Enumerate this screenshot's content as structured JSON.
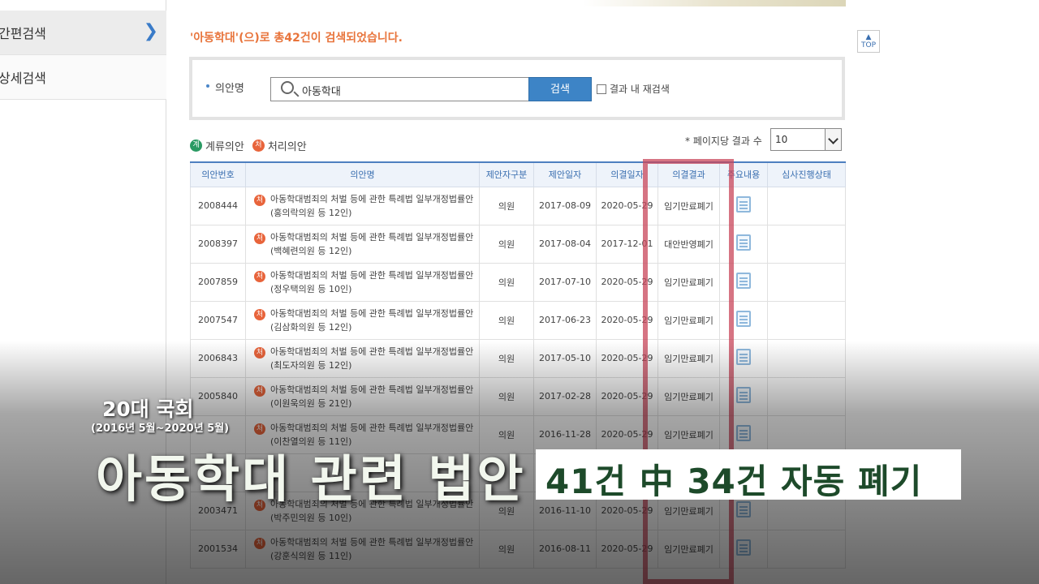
{
  "sidebar": {
    "items": [
      {
        "label": "간편검색",
        "active": true
      },
      {
        "label": "상세검색",
        "active": false
      }
    ]
  },
  "result_summary": "'아동학대'(으)로 총42건이 검색되었습니다.",
  "top_button": "TOP",
  "search": {
    "label": "의안명",
    "value": "아동학대",
    "button": "검색",
    "within_results_label": "결과 내 재검색"
  },
  "legend": {
    "pending_badge": "계",
    "pending_label": "계류의안",
    "processed_badge": "처",
    "processed_label": "처리의안"
  },
  "page_size": {
    "label": "페이지당 결과 수",
    "value": "10"
  },
  "table": {
    "headers": [
      "의안번호",
      "의안명",
      "제안자구분",
      "제안일자",
      "의결일자",
      "의결결과",
      "주요내용",
      "심사진행상태"
    ],
    "rows": [
      {
        "no": "2008444",
        "title": "아동학대범죄의 처벌 등에 관한 특례법 일부개정법률안(홍의락의원 등 12인)",
        "proposer": "의원",
        "proposed": "2017-08-09",
        "decided": "2020-05-29",
        "result": "임기만료폐기"
      },
      {
        "no": "2008397",
        "title": "아동학대범죄의 처벌 등에 관한 특례법 일부개정법률안(백혜련의원 등 12인)",
        "proposer": "의원",
        "proposed": "2017-08-04",
        "decided": "2017-12-01",
        "result": "대안반영폐기"
      },
      {
        "no": "2007859",
        "title": "아동학대범죄의 처벌 등에 관한 특례법 일부개정법률안(정우택의원 등 10인)",
        "proposer": "의원",
        "proposed": "2017-07-10",
        "decided": "2020-05-29",
        "result": "임기만료폐기"
      },
      {
        "no": "2007547",
        "title": "아동학대범죄의 처벌 등에 관한 특례법 일부개정법률안(김삼화의원 등 12인)",
        "proposer": "의원",
        "proposed": "2017-06-23",
        "decided": "2020-05-29",
        "result": "임기만료폐기"
      },
      {
        "no": "2006843",
        "title": "아동학대범죄의 처벌 등에 관한 특례법 일부개정법률안(최도자의원 등 12인)",
        "proposer": "의원",
        "proposed": "2017-05-10",
        "decided": "2020-05-29",
        "result": "임기만료폐기"
      },
      {
        "no": "2005840",
        "title": "아동학대범죄의 처벌 등에 관한 특례법 일부개정법률안(이원욱의원 등 21인)",
        "proposer": "의원",
        "proposed": "2017-02-28",
        "decided": "2020-05-29",
        "result": "임기만료폐기"
      },
      {
        "no": "",
        "title": "아동학대범죄의 처벌 등에 관한 특례법 일부개정법률안(이찬열의원 등 11인)",
        "proposer": "의원",
        "proposed": "2016-11-28",
        "decided": "2020-05-29",
        "result": "임기만료폐기"
      },
      {
        "no": "",
        "title": "",
        "proposer": "",
        "proposed": "",
        "decided": "",
        "result": ""
      },
      {
        "no": "2003471",
        "title": "아동학대범죄의 처벌 등에 관한 특례법 일부개정법률안(박주민의원 등 10인)",
        "proposer": "의원",
        "proposed": "2016-11-10",
        "decided": "2020-05-29",
        "result": "임기만료폐기"
      },
      {
        "no": "2001534",
        "title": "아동학대범죄의 처벌 등에 관한 특례법 일부개정법률안(강훈식의원 등 11인)",
        "proposer": "의원",
        "proposed": "2016-08-11",
        "decided": "2020-05-29",
        "result": "임기만료폐기"
      }
    ]
  },
  "caption": {
    "small": "20대 국회",
    "sub": "(2016년 5월~2020년 5월)",
    "main": "아동학대 관련 법안",
    "box": "41건 中 34건 자동 폐기"
  }
}
